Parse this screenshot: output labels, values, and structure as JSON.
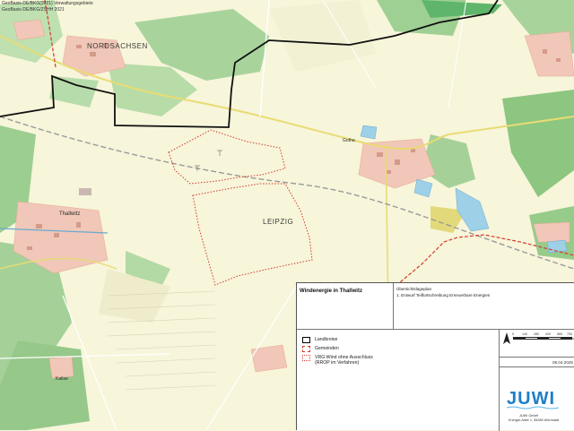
{
  "copyright": [
    "GeoBasis-DE/BKG(2021) Verwaltungsgebiete",
    "GeoBasis-DE/BKG/ZSHH 2021"
  ],
  "labels": {
    "nordsachsen": "NORDSACHSEN",
    "leipzig": "LEIPZIG",
    "thallwitz": "Thallwitz",
    "north_town": "Gotha",
    "bottom_village": "Kaltse"
  },
  "legend": {
    "title": "Windenergie in Thallwitz",
    "subtitle_1": "Übersichtslageplan",
    "subtitle_2": "1. Entwurf Teilfortschreibung Erneuerbare Energien",
    "items": [
      {
        "text": "Landkreise",
        "color": "#000000",
        "style": "solid"
      },
      {
        "text": "Gemeinden",
        "color": "#d23c2c",
        "style": "dashed"
      },
      {
        "text": "VRG Wind ohne Ausschluss\n(RROP im Verfahren)",
        "color": "#d23c2c",
        "style": "dotted"
      }
    ],
    "scale_ticks": [
      "0",
      "140",
      "280",
      "420",
      "560",
      "700"
    ],
    "scale_unit": "m",
    "date": "08.04.2025",
    "company": "JUWI GmbH",
    "address": "Energie-Allee 1, 55286 Wörrstadt",
    "logo": "JUWI"
  }
}
